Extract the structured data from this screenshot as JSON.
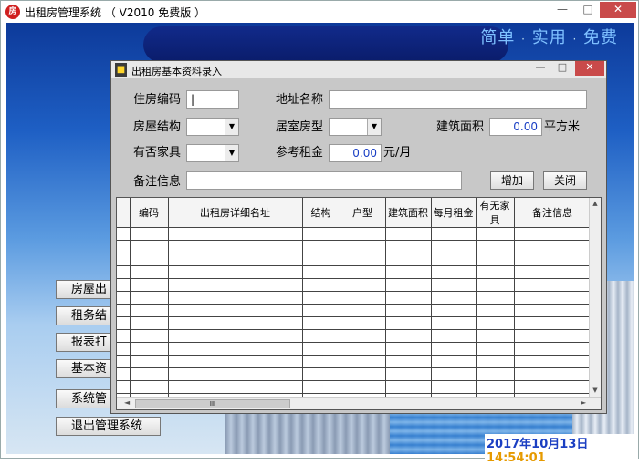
{
  "main_window": {
    "title": "出租房管理系统 （ V2010 免费版 ）",
    "app_icon": "house-logo-icon",
    "controls": {
      "minimize": "—",
      "maximize": "□",
      "close": "✕"
    }
  },
  "slogan": {
    "part1": "简单",
    "part2": "实用",
    "part3": "免费",
    "sep": "·"
  },
  "side_menu": [
    {
      "label": "房屋出"
    },
    {
      "label": "租务结"
    },
    {
      "label": "报表打"
    },
    {
      "label": "基本资"
    },
    {
      "label": "系统管"
    },
    {
      "label": "退出管理系统"
    }
  ],
  "status": {
    "date": "2017年10月13日",
    "time": "14:54:01"
  },
  "dialog": {
    "title": "出租房基本资料录入",
    "controls": {
      "minimize": "—",
      "maximize": "□",
      "close": "✕"
    },
    "labels": {
      "house_code": "住房编码",
      "address": "地址名称",
      "structure": "房屋结构",
      "room_type": "居室房型",
      "area": "建筑面积",
      "area_unit": "平方米",
      "furniture": "有否家具",
      "rent": "参考租金",
      "rent_unit": "元/月",
      "remark": "备注信息"
    },
    "values": {
      "house_code": "|",
      "address": "",
      "structure": "",
      "room_type": "",
      "area": "0.00",
      "furniture": "",
      "rent": "0.00",
      "remark": ""
    },
    "buttons": {
      "add": "增加",
      "close": "关闭"
    },
    "grid": {
      "columns": [
        "编码",
        "出租房详细名址",
        "结构",
        "户型",
        "建筑面积",
        "每月租金",
        "有无家具",
        "备注信息"
      ],
      "scroll_thumb": "III",
      "arrow_up": "▲",
      "arrow_down": "▼",
      "arrow_left": "◄",
      "arrow_right": "►"
    }
  }
}
